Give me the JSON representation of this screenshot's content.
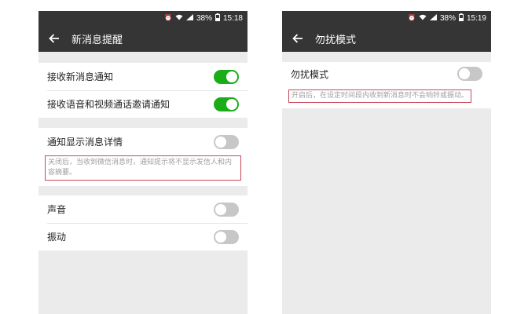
{
  "colors": {
    "toolbar_bg": "#353535",
    "toggle_on": "#1aad19",
    "toggle_off": "#c7c7c7",
    "highlight_border": "#c8485a",
    "page_bg": "#ebebeb"
  },
  "left": {
    "status": {
      "battery": "38%",
      "time": "15:18"
    },
    "title": "新消息提醒",
    "sections": {
      "receive_new": {
        "label": "接收新消息通知",
        "on": true
      },
      "receive_call": {
        "label": "接收语音和视频通话邀请通知",
        "on": true
      },
      "show_detail": {
        "label": "通知显示消息详情",
        "on": false
      },
      "show_detail_hint": "关闭后，当收到微信消息时，通知提示将不显示发信人和内容摘要。",
      "sound": {
        "label": "声音",
        "on": false
      },
      "vibrate": {
        "label": "振动",
        "on": false
      }
    }
  },
  "right": {
    "status": {
      "battery": "38%",
      "time": "15:19"
    },
    "title": "勿扰模式",
    "dnd": {
      "label": "勿扰模式",
      "on": false
    },
    "dnd_hint": "开启后，在设定时间段内收到新消息时不会响铃或振动。"
  }
}
